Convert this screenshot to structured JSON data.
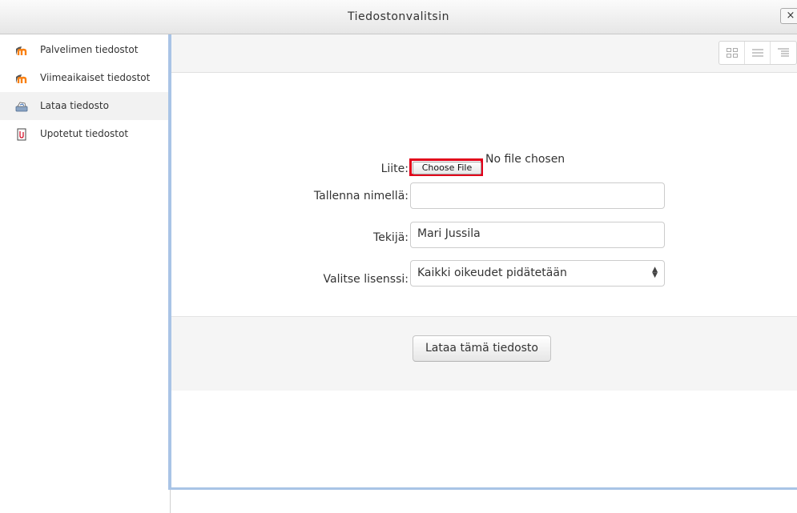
{
  "window": {
    "title": "Tiedostonvalitsin",
    "close_label": "×"
  },
  "sidebar": {
    "items": [
      {
        "label": "Palvelimen tiedostot",
        "icon": "moodle-icon"
      },
      {
        "label": "Viimeaikaiset tiedostot",
        "icon": "moodle-icon"
      },
      {
        "label": "Lataa tiedosto",
        "icon": "upload-icon",
        "active": true
      },
      {
        "label": "Upotetut tiedostot",
        "icon": "embedded-files-icon"
      }
    ]
  },
  "toolbar": {
    "view_modes": [
      "icons-view",
      "list-view",
      "tree-view"
    ]
  },
  "form": {
    "attachment_label": "Liite:",
    "choose_file_label": "Choose File",
    "no_file_text": "No file chosen",
    "save_as_label": "Tallenna nimellä:",
    "save_as_value": "",
    "author_label": "Tekijä:",
    "author_value": "Mari Jussila",
    "license_label": "Valitse lisenssi:",
    "license_value": "Kaikki oikeudet pidätetään",
    "submit_label": "Lataa tämä tiedosto"
  },
  "colors": {
    "highlight": "#e2001a",
    "panel_border": "#a9c4e6",
    "moodle_orange": "#f98012"
  }
}
